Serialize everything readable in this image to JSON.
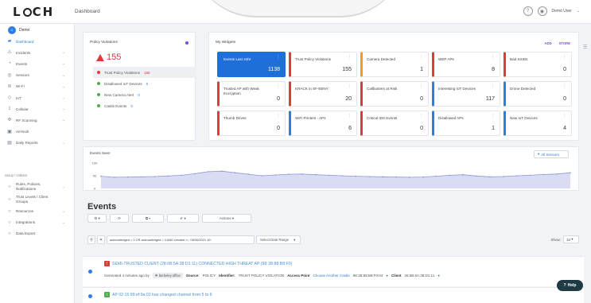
{
  "app": {
    "logo": "LOCH",
    "page_title": "Dashboard",
    "user_name": "Demo User"
  },
  "sidebar": {
    "org_label": "Demo",
    "items": [
      {
        "label": "Dashboard",
        "icon": "dashboard-icon",
        "chev": ""
      },
      {
        "label": "Incidents",
        "icon": "warning-icon",
        "chev": "⌄"
      },
      {
        "label": "Events",
        "icon": "events-icon",
        "chev": "⌄"
      },
      {
        "label": "Sensors",
        "icon": "sensor-icon",
        "chev": "⌄"
      },
      {
        "label": "Wi-Fi",
        "icon": "wifi-icon",
        "chev": "⌄"
      },
      {
        "label": "IoT",
        "icon": "iot-icon",
        "chev": "⌄"
      },
      {
        "label": "Cellular",
        "icon": "cellular-icon",
        "chev": "⌄"
      },
      {
        "label": "RF Scanning",
        "icon": "rf-icon",
        "chev": "⌄"
      },
      {
        "label": "AirHook",
        "icon": "airhook-icon",
        "chev": ""
      },
      {
        "label": "Daily Reports",
        "icon": "reports-icon",
        "chev": "⌄"
      }
    ],
    "section_label": "Setup / Utilities",
    "setup_items": [
      {
        "label": "Rules, Policies, Notifications",
        "chev": "⌄"
      },
      {
        "label": "Trust Levels / Client Groups",
        "chev": ""
      },
      {
        "label": "Resources",
        "chev": "⌄"
      },
      {
        "label": "Integrations",
        "chev": "⌄"
      },
      {
        "label": "Data Export",
        "chev": ""
      }
    ]
  },
  "policy": {
    "title": "Policy Violations",
    "count": "155",
    "items": [
      {
        "label": "Trust Policy Violations",
        "count": "155",
        "color": "#e0393e"
      },
      {
        "label": "Disallowed IoT Devices",
        "count": "0",
        "color": "#4caf50"
      },
      {
        "label": "New Camera Alert",
        "count": "0",
        "color": "#4caf50"
      },
      {
        "label": "Castle Events",
        "count": "0",
        "color": "#4caf50"
      }
    ]
  },
  "widgets": {
    "title": "My Widgets",
    "add_label": "ADD",
    "store_label": "STORE",
    "tiles": [
      {
        "name": "Events Last 24hr",
        "value": "1138",
        "color": "#1f6fd9",
        "filled": true
      },
      {
        "name": "Trust Policy Violations",
        "value": "155",
        "color": "#e0393e"
      },
      {
        "name": "Camera Detected",
        "value": "1",
        "color": "#f39c12"
      },
      {
        "name": "WEP APs",
        "value": "8",
        "color": "#e0393e"
      },
      {
        "name": "Bad SSIDs",
        "value": "0",
        "color": "#e0393e"
      },
      {
        "name": "Trusted AP with Weak Encryption",
        "value": "0",
        "color": "#e0393e"
      },
      {
        "name": "KRACK in SF-EBNY",
        "value": "20",
        "color": "#e0393e"
      },
      {
        "name": "Callbusters at Risk",
        "value": "0",
        "color": "#e0393e"
      },
      {
        "name": "Interesting IoT Devices",
        "value": "117",
        "color": "#2f7de1"
      },
      {
        "name": "Drone Detected",
        "value": "0",
        "color": "#2f7de1"
      },
      {
        "name": "Thumb Drives",
        "value": "0",
        "color": "#e0393e"
      },
      {
        "name": "WiFi Printers - APs",
        "value": "6",
        "color": "#2f7de1"
      },
      {
        "name": "Critical IDS Events",
        "value": "0",
        "color": "#e0393e"
      },
      {
        "name": "Disallowed APs",
        "value": "1",
        "color": "#2f7de1"
      },
      {
        "name": "New IoT Devices",
        "value": "4",
        "color": "#2f7de1"
      },
      {
        "name": "",
        "value": "",
        "color": "#2f7de1"
      },
      {
        "name": "",
        "value": "",
        "color": "#2f7de1"
      },
      {
        "name": "",
        "value": "",
        "color": "#2f7de1"
      },
      {
        "name": "",
        "value": "",
        "color": "#2f7de1"
      },
      {
        "name": "",
        "value": "",
        "color": "#2f7de1"
      }
    ]
  },
  "chart_data": {
    "type": "area",
    "title": "Events Seen",
    "y_ticks": [
      "100",
      "50",
      "0"
    ],
    "ylim": [
      0,
      100
    ],
    "values": [
      48,
      44,
      45,
      46,
      47,
      49,
      52,
      58,
      66,
      68,
      62,
      56,
      50,
      53,
      56,
      57,
      54,
      52,
      50,
      48,
      47,
      46,
      45,
      44,
      45,
      48,
      52,
      54,
      49,
      46,
      47,
      50,
      52,
      55,
      57,
      62
    ],
    "color": "#8d97d8",
    "grid": false
  },
  "seen_selector": "All Sensors",
  "events": {
    "heading": "Events",
    "toolbar": [
      "⚙ ▾",
      "⟳",
      "⧉ ▾",
      "✔ ▾",
      "Actions ▾"
    ],
    "filter_query": "acknowledged = 1 OR acknowledged = 0 AND created >= '08/30/2021 10:'",
    "date_range_label": "Select Date Range",
    "show_label": "Show:",
    "show_value": "10",
    "rows": [
      {
        "severity": "!",
        "severity_color": "#e0393e",
        "title": "SEMI-TRUSTED CLIENT (28:6B:5A:38:D1:11) CONNECTED HIGH THREAT AP (98:1B:88:B8:F0)",
        "generated": "Generated 4 minutes ago by",
        "by_chip": "berkeley-office",
        "source_label": "Source:",
        "source_val": "POLICY",
        "identifier_label": "Identifier:",
        "identifier_val": "TRUST POLICY VIOLATION",
        "ap_label": "Access Point",
        "ap_link": "Choose Another Castle",
        "ap_mac": "98:1B:88:B8:F0:04",
        "client_label": "Client",
        "client_mac": "28:6B:5A:38:D1:11"
      },
      {
        "severity": "i",
        "severity_color": "#4caf50",
        "title": "AP 02:15:99:ef:9a:02 has changed channel from 5 to 6"
      }
    ]
  },
  "help_label": "Help"
}
